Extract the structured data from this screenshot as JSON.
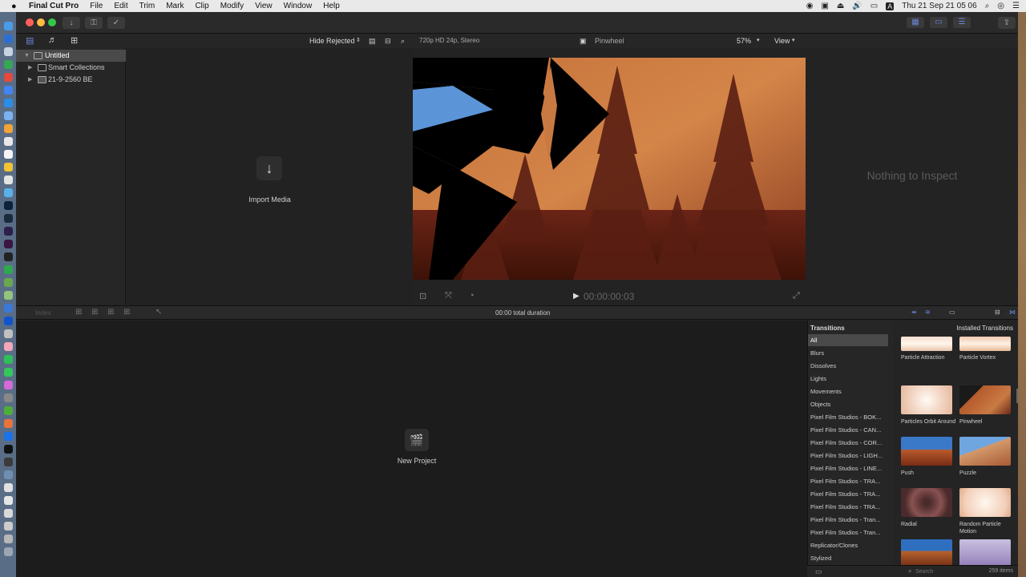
{
  "menubar": {
    "apple": "",
    "app_name": "Final Cut Pro",
    "items": [
      "File",
      "Edit",
      "Trim",
      "Mark",
      "Clip",
      "Modify",
      "View",
      "Window",
      "Help"
    ],
    "clock": "Thu 21 Sep 21 05 06",
    "keyboard_letter": "A"
  },
  "library": {
    "items": [
      {
        "label": "Untitled",
        "selected": true
      },
      {
        "label": "Smart Collections",
        "selected": false
      },
      {
        "label": "21-9-2560 BE",
        "selected": false
      }
    ]
  },
  "browser_toolbar": {
    "filter": "Hide Rejected",
    "format": "720p HD 24p, Stereo",
    "clip_name": "Pinwheel",
    "zoom": "57%",
    "view_menu": "View"
  },
  "browser": {
    "import_icon": "↓",
    "import_label": "Import Media"
  },
  "viewer": {
    "timecode": "00:00:00:03"
  },
  "inspector": {
    "empty_text": "Nothing to Inspect"
  },
  "timeline_toolbar": {
    "index_label": "Index",
    "duration": "00:00 total duration"
  },
  "timeline": {
    "new_project_icon": "🎬",
    "new_project_label": "New Project"
  },
  "transitions": {
    "header": "Transitions",
    "source": "Installed Transitions",
    "categories": [
      {
        "label": "All",
        "selected": true
      },
      {
        "label": "Blurs"
      },
      {
        "label": "Dissolves"
      },
      {
        "label": "Lights"
      },
      {
        "label": "Movements"
      },
      {
        "label": "Objects"
      },
      {
        "label": "Pixel Film Studios - BOK..."
      },
      {
        "label": "Pixel Film Studios - CAN..."
      },
      {
        "label": "Pixel Film Studios - COR..."
      },
      {
        "label": "Pixel Film Studios - LIGH..."
      },
      {
        "label": "Pixel Film Studios - LINE..."
      },
      {
        "label": "Pixel Film Studios - TRA..."
      },
      {
        "label": "Pixel Film Studios - TRA..."
      },
      {
        "label": "Pixel Film Studios - TRA..."
      },
      {
        "label": "Pixel Film Studios - Tran..."
      },
      {
        "label": "Pixel Film Studios - Tran..."
      },
      {
        "label": "Replicator/Clones"
      },
      {
        "label": "Stylized"
      }
    ],
    "items": [
      {
        "label": "Particle Attraction"
      },
      {
        "label": "Particle Vortex"
      },
      {
        "label": "Particles Orbit Around"
      },
      {
        "label": "Pinwheel"
      },
      {
        "label": "Push"
      },
      {
        "label": "Puzzle"
      },
      {
        "label": "Radial"
      },
      {
        "label": "Random Particle Motion"
      },
      {
        "label": ""
      },
      {
        "label": ""
      }
    ],
    "search_placeholder": "Search",
    "count": "259 items"
  },
  "colors": {
    "accent_blue": "#6c86d9",
    "selection": "#4a4a4a"
  }
}
